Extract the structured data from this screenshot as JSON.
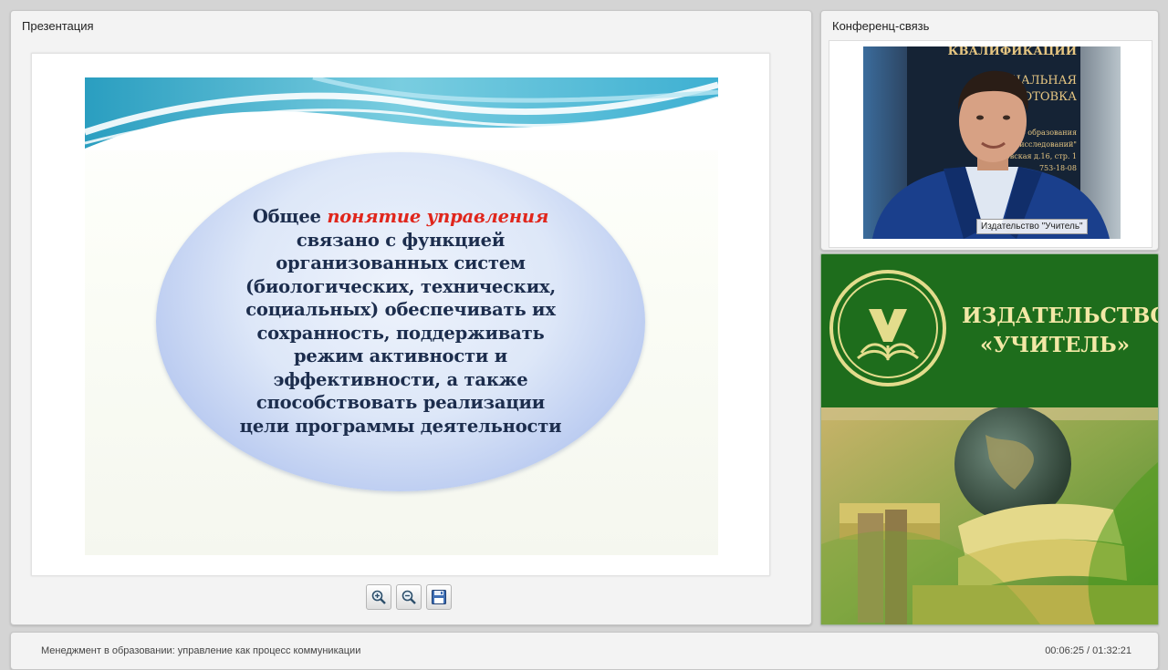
{
  "presentation": {
    "title": "Презентация",
    "slide": {
      "text_before": "Общее ",
      "highlight": "понятие управления",
      "lines": [
        "связано с функцией",
        "организованных систем",
        "(биологических, технических,",
        "социальных) обеспечивать их",
        "сохранность, поддерживать",
        "режим активности и",
        "эффективности, а также",
        "способствовать реализации",
        "цели программы деятельности"
      ]
    },
    "toolbar": {
      "zoom_in": "zoom-in-icon",
      "zoom_out": "zoom-out-icon",
      "save": "save-icon"
    }
  },
  "conference": {
    "title": "Конференц-связь",
    "caption": "Издательство \"Учитель\"",
    "background_sign": [
      "КВАЛИФИКАЦИИ",
      "ОНАЛЬНАЯ",
      "ОДГОТОВКА",
      "центр образования",
      "рных исследований\"",
      "ковская д.16, стр. 1",
      "753-18-08"
    ]
  },
  "promo": {
    "title_line1": "ИЗДАТЕЛЬСТВО",
    "title_line2": "«УЧИТЕЛЬ»"
  },
  "status": {
    "course_title": "Менеджмент в образовании: управление как процесс коммуникации",
    "time": "00:06:25 / 01:32:21"
  },
  "colors": {
    "highlight": "#e0261c",
    "promo_green": "#1e6d1c",
    "promo_gold": "#f3e8a6",
    "slide_text": "#1c2d4d"
  }
}
